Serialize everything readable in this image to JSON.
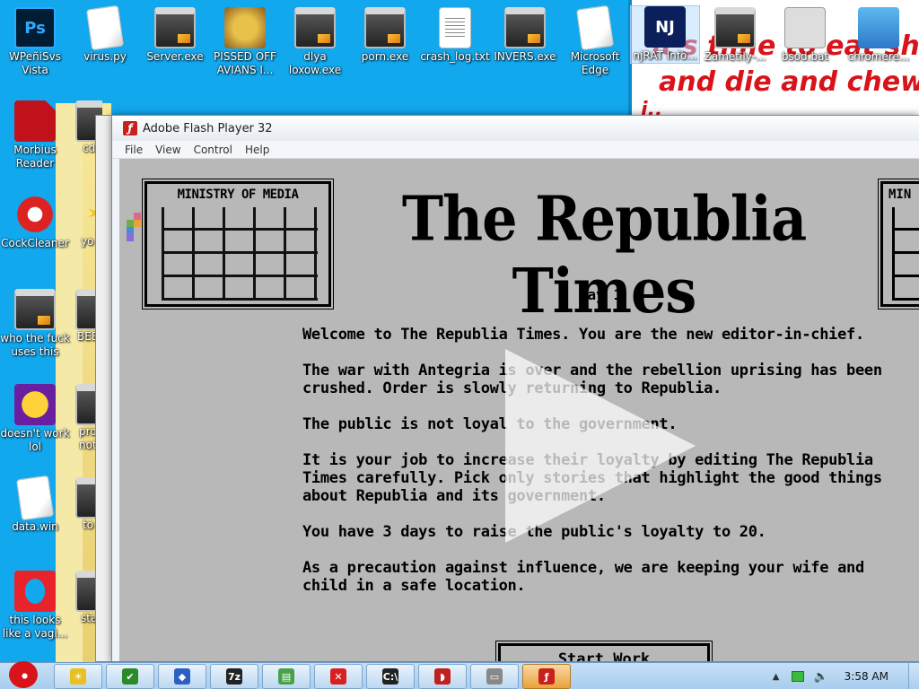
{
  "desktop": {
    "meme_text": [
      "it's time to eat shit",
      "and die and chew",
      "i.."
    ],
    "icons": [
      {
        "label": "WPeñiSvs Vista",
        "glyph": "Ps",
        "kind": "photoshop-icon"
      },
      {
        "label": "virus.py",
        "glyph": "",
        "kind": "document-icon"
      },
      {
        "label": "Server.exe",
        "glyph": "",
        "kind": "exe-icon"
      },
      {
        "label": "PISSED OFF AVIANS I...",
        "glyph": "",
        "kind": "angry-birds-icon"
      },
      {
        "label": "dlya loxow.exe",
        "glyph": "",
        "kind": "exe-icon"
      },
      {
        "label": "porn.exe",
        "glyph": "",
        "kind": "exe-icon"
      },
      {
        "label": "crash_log.txt",
        "glyph": "",
        "kind": "text-file-icon"
      },
      {
        "label": "INVERS.exe",
        "glyph": "",
        "kind": "exe-icon"
      },
      {
        "label": "Microsoft Edge",
        "glyph": "",
        "kind": "document-icon"
      },
      {
        "label": "njRAT Info...",
        "glyph": "NJ",
        "kind": "njrat-icon"
      },
      {
        "label": "Zametily-...",
        "glyph": "",
        "kind": "exe-icon"
      },
      {
        "label": "bsod.bat",
        "glyph": "",
        "kind": "batch-file-icon"
      },
      {
        "label": "chromere...",
        "glyph": "",
        "kind": "installer-icon"
      },
      {
        "label": "Morbius Reader",
        "glyph": "",
        "kind": "pdf-reader-icon"
      },
      {
        "label": "CockCleaner",
        "glyph": "C",
        "kind": "cleaner-icon"
      },
      {
        "label": "who the fuck uses this",
        "glyph": "",
        "kind": "exe-icon"
      },
      {
        "label": "doesn't work lol",
        "glyph": "Y!",
        "kind": "yahoo-messenger-icon"
      },
      {
        "label": "data.win",
        "glyph": "",
        "kind": "document-icon"
      },
      {
        "label": "this looks like a vagi...",
        "glyph": "O",
        "kind": "opera-icon"
      }
    ],
    "col2_partial": [
      "cd",
      "yo",
      "BEE",
      "pro not",
      "to",
      "startl"
    ]
  },
  "window": {
    "title": "Adobe Flash Player 32",
    "menu": [
      "File",
      "View",
      "Control",
      "Help"
    ]
  },
  "game": {
    "ministry_label": "MINISTRY OF MEDIA",
    "ministry_label_partial": "MIN",
    "masthead": "The Republia Times",
    "day": "Day 1",
    "paragraphs": [
      "Welcome to The Republia Times. You are the new editor-in-chief.",
      "The war with Antegria is over and the rebellion uprising has been\ncrushed. Order is slowly returning to Republia.",
      "The public is not loyal to the government.",
      "It is your job to increase their loyalty by editing The Republia\nTimes carefully. Pick only stories that highlight the good things\nabout Republia and its government.",
      "You have 3 days to raise the public's loyalty to 20.",
      "As a precaution against influence, we are keeping your wife and\nchild in a safe location."
    ],
    "start_button": "Start Work"
  },
  "taskbar": {
    "items": [
      {
        "name": "explorer-taskbar-button",
        "glyph": "☀",
        "color": "#e8c020"
      },
      {
        "name": "media-taskbar-button",
        "glyph": "✔",
        "color": "#2a8a2a"
      },
      {
        "name": "network-taskbar-button",
        "glyph": "◆",
        "color": "#2a60c0"
      },
      {
        "name": "7zip-taskbar-button",
        "glyph": "7z",
        "color": "#222222"
      },
      {
        "name": "notepad-taskbar-button",
        "glyph": "▤",
        "color": "#4aa04a"
      },
      {
        "name": "error-taskbar-button",
        "glyph": "✕",
        "color": "#d82020"
      },
      {
        "name": "cmd-taskbar-button",
        "glyph": "C:\\",
        "color": "#222222"
      },
      {
        "name": "paint-taskbar-button",
        "glyph": "◗",
        "color": "#c02020"
      },
      {
        "name": "drive-taskbar-button",
        "glyph": "▭",
        "color": "#888888"
      },
      {
        "name": "flash-taskbar-button",
        "glyph": "ƒ",
        "color": "#c8201a"
      }
    ],
    "clock": "3:58 AM"
  },
  "colors": {
    "desktop_bg": "#12a8ee",
    "game_bg": "#b8b8b8",
    "accent_red": "#d8131a"
  }
}
